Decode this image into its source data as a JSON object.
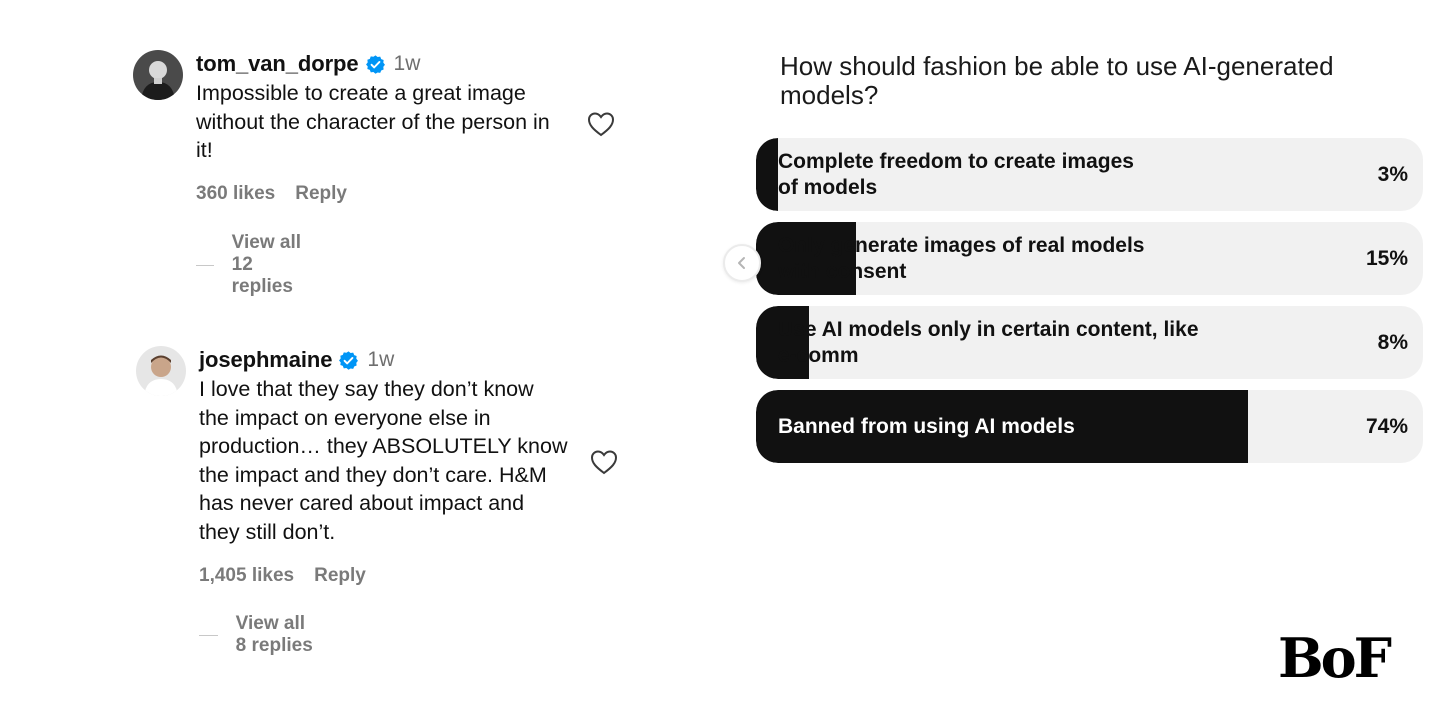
{
  "comments": [
    {
      "username": "tom_van_dorpe",
      "time": "1w",
      "text": "Impossible to create a great image without the character of the person in it!",
      "likes": "360 likes",
      "reply": "Reply",
      "view_replies": "View all 12 replies",
      "avatar_icon": "person-portrait-icon"
    },
    {
      "username": "josephmaine",
      "time": "1w",
      "text": "I love that they say they don’t know the impact on everyone else in production… they ABSOLUTELY know the impact and they don’t care. H&M has never cared about impact and they still don’t.",
      "likes": "1,405 likes",
      "reply": "Reply",
      "view_replies": "View all 8 replies",
      "avatar_icon": "person-portrait-icon"
    }
  ],
  "poll": {
    "question": "How should fashion be able to use AI-generated models?",
    "options": [
      {
        "label": "Complete freedom to create images\nof models",
        "percent_text": "3%",
        "percent": 3
      },
      {
        "label": "Only generate images of real models\nwith consent",
        "percent_text": "15%",
        "percent": 15
      },
      {
        "label": "Use AI models only in certain content, like\ne-comm",
        "percent_text": "8%",
        "percent": 8
      },
      {
        "label": "Banned from using AI models",
        "percent_text": "74%",
        "percent": 74
      }
    ]
  },
  "icons": {
    "verified": "verified-badge-icon",
    "heart": "heart-outline-icon",
    "prev": "chevron-left-icon"
  },
  "colors": {
    "verified_blue": "#0095f6",
    "poll_fill": "#111111",
    "poll_track": "#f1f1f1",
    "meta_gray": "#7a7a7a"
  },
  "logo": {
    "text": "BoF"
  }
}
